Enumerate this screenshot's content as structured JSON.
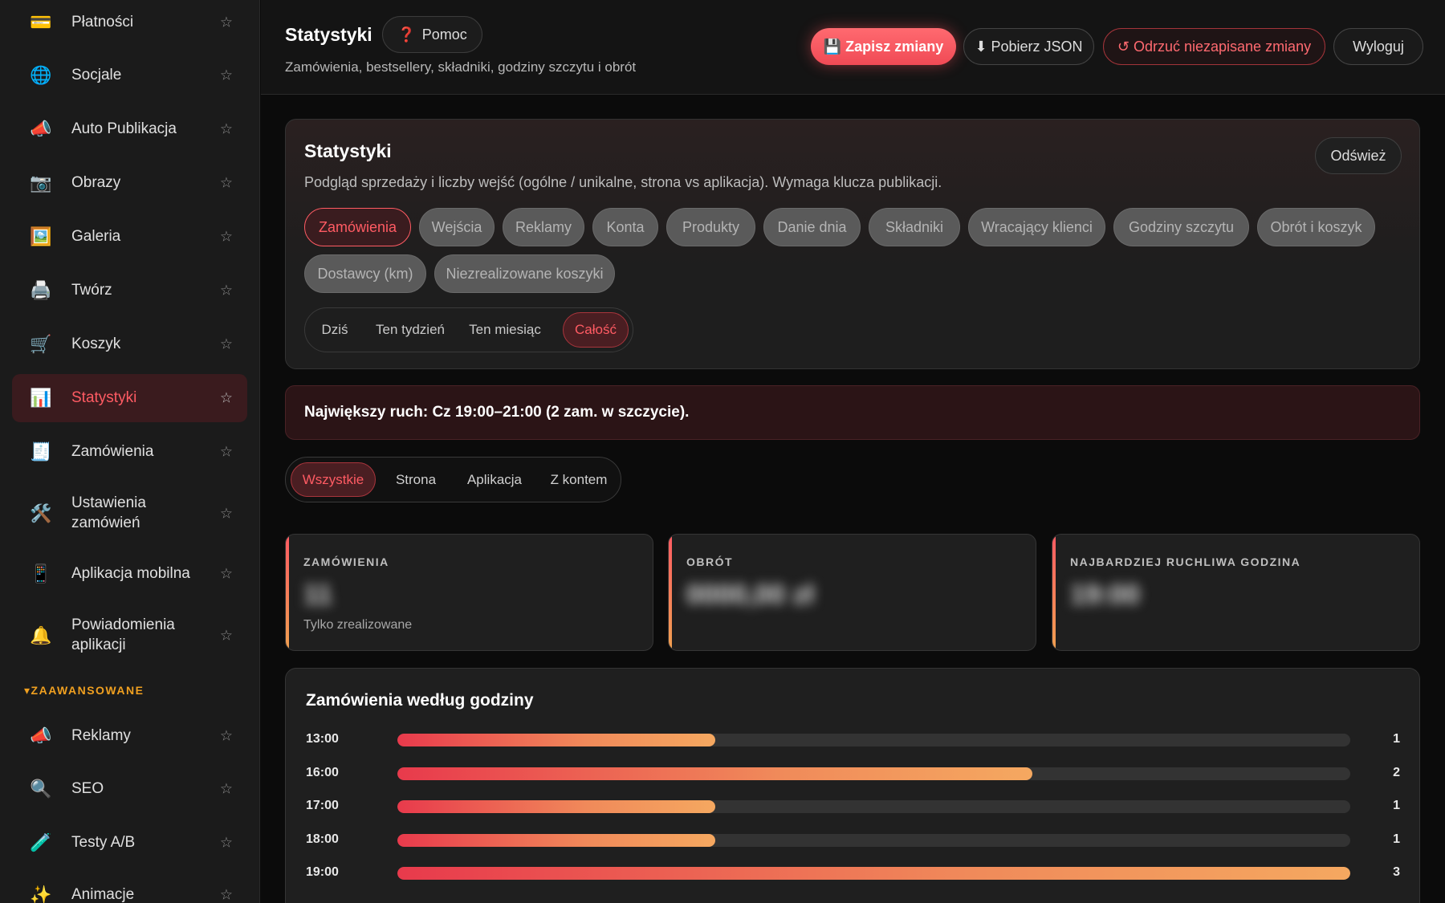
{
  "sidebar": {
    "items": [
      {
        "label": "Płatności",
        "icon": "credit-card-icon",
        "glyph": "💳",
        "active": false
      },
      {
        "label": "Socjale",
        "icon": "globe-icon",
        "glyph": "🌐",
        "active": false
      },
      {
        "label": "Auto Publikacja",
        "icon": "megaphone-icon",
        "glyph": "📣",
        "active": false
      },
      {
        "label": "Obrazy",
        "icon": "camera-icon",
        "glyph": "📷",
        "active": false
      },
      {
        "label": "Galeria",
        "icon": "picture-icon",
        "glyph": "🖼️",
        "active": false
      },
      {
        "label": "Twórz",
        "icon": "printer-icon",
        "glyph": "🖨️",
        "active": false
      },
      {
        "label": "Koszyk",
        "icon": "cart-icon",
        "glyph": "🛒",
        "active": false
      },
      {
        "label": "Statystyki",
        "icon": "bar-chart-icon",
        "glyph": "📊",
        "active": true
      },
      {
        "label": "Zamówienia",
        "icon": "receipt-icon",
        "glyph": "🧾",
        "active": false
      },
      {
        "label": "Ustawienia zamówień",
        "icon": "tools-icon",
        "glyph": "🛠️",
        "active": false
      },
      {
        "label": "Aplikacja mobilna",
        "icon": "mobile-app-icon",
        "glyph": "📱",
        "active": false
      },
      {
        "label": "Powiadomienia aplikacji",
        "icon": "bell-icon",
        "glyph": "🔔",
        "active": false
      }
    ],
    "advanced_heading": "▾ZAAWANSOWANE",
    "advanced_items": [
      {
        "label": "Reklamy",
        "icon": "megaphone-icon",
        "glyph": "📣"
      },
      {
        "label": "SEO",
        "icon": "magnifier-icon",
        "glyph": "🔍"
      },
      {
        "label": "Testy A/B",
        "icon": "test-tube-icon",
        "glyph": "🧪"
      },
      {
        "label": "Animacje",
        "icon": "sparkles-icon",
        "glyph": "✨"
      }
    ],
    "star_glyph": "☆"
  },
  "header": {
    "title": "Statystyki",
    "help_label": "Pomoc",
    "help_glyph": "❓",
    "subtitle": "Zamówienia, bestsellery, składniki, godziny szczytu i obrót",
    "save_label": "💾 Zapisz zmiany",
    "json_label": "⬇ Pobierz JSON",
    "discard_label": "↺ Odrzuć niezapisane zmiany",
    "logout_label": "Wyloguj"
  },
  "stats": {
    "title": "Statystyki",
    "description": "Podgląd sprzedaży i liczby wejść (ogólne / unikalne, strona vs aplikacja). Wymaga klucza publikacji.",
    "refresh_label": "Odśwież",
    "tabs": [
      {
        "label": "Zamówienia",
        "active": true
      },
      {
        "label": "Wejścia",
        "active": false
      },
      {
        "label": "Reklamy",
        "active": false
      },
      {
        "label": "Konta",
        "active": false
      },
      {
        "label": "Produkty",
        "active": false
      },
      {
        "label": "Danie dnia",
        "active": false
      },
      {
        "label": "Składniki",
        "active": false
      },
      {
        "label": "Wracający klienci",
        "active": false
      },
      {
        "label": "Godziny szczytu",
        "active": false
      },
      {
        "label": "Obrót i koszyk",
        "active": false
      },
      {
        "label": "Dostawcy (km)",
        "active": false
      },
      {
        "label": "Niezrealizowane koszyki",
        "active": false
      }
    ],
    "periods": [
      {
        "label": "Dziś",
        "active": false
      },
      {
        "label": "Ten tydzień",
        "active": false
      },
      {
        "label": "Ten miesiąc",
        "active": false
      },
      {
        "label": "Całość",
        "active": true
      }
    ]
  },
  "peak_banner": "Największy ruch: Cz 19:00–21:00 (2 zam. w szczycie).",
  "sources": [
    {
      "label": "Wszystkie",
      "active": true
    },
    {
      "label": "Strona",
      "active": false
    },
    {
      "label": "Aplikacja",
      "active": false
    },
    {
      "label": "Z kontem",
      "active": false
    }
  ],
  "cards": [
    {
      "label": "ZAMÓWIENIA",
      "value": "11",
      "note": "Tylko zrealizowane"
    },
    {
      "label": "OBRÓT",
      "value": "0000,00 zł",
      "note": ""
    },
    {
      "label": "NAJBARDZIEJ RUCHLIWA GODZINA",
      "value": "19:00",
      "note": ""
    }
  ],
  "chart_data": {
    "type": "bar",
    "orientation": "horizontal",
    "title": "Zamówienia według godziny",
    "categories": [
      "13:00",
      "16:00",
      "17:00",
      "18:00",
      "19:00"
    ],
    "values": [
      1,
      2,
      1,
      1,
      3
    ],
    "xlim": [
      0,
      3
    ],
    "colors": {
      "start": "#e83a4c",
      "end": "#f5a860",
      "track": "#333333"
    }
  },
  "colors": {
    "accent": "#ff5b63",
    "background": "#0b0b0b",
    "sidebar": "#1b1b1b",
    "advanced_heading": "#f0a020"
  }
}
